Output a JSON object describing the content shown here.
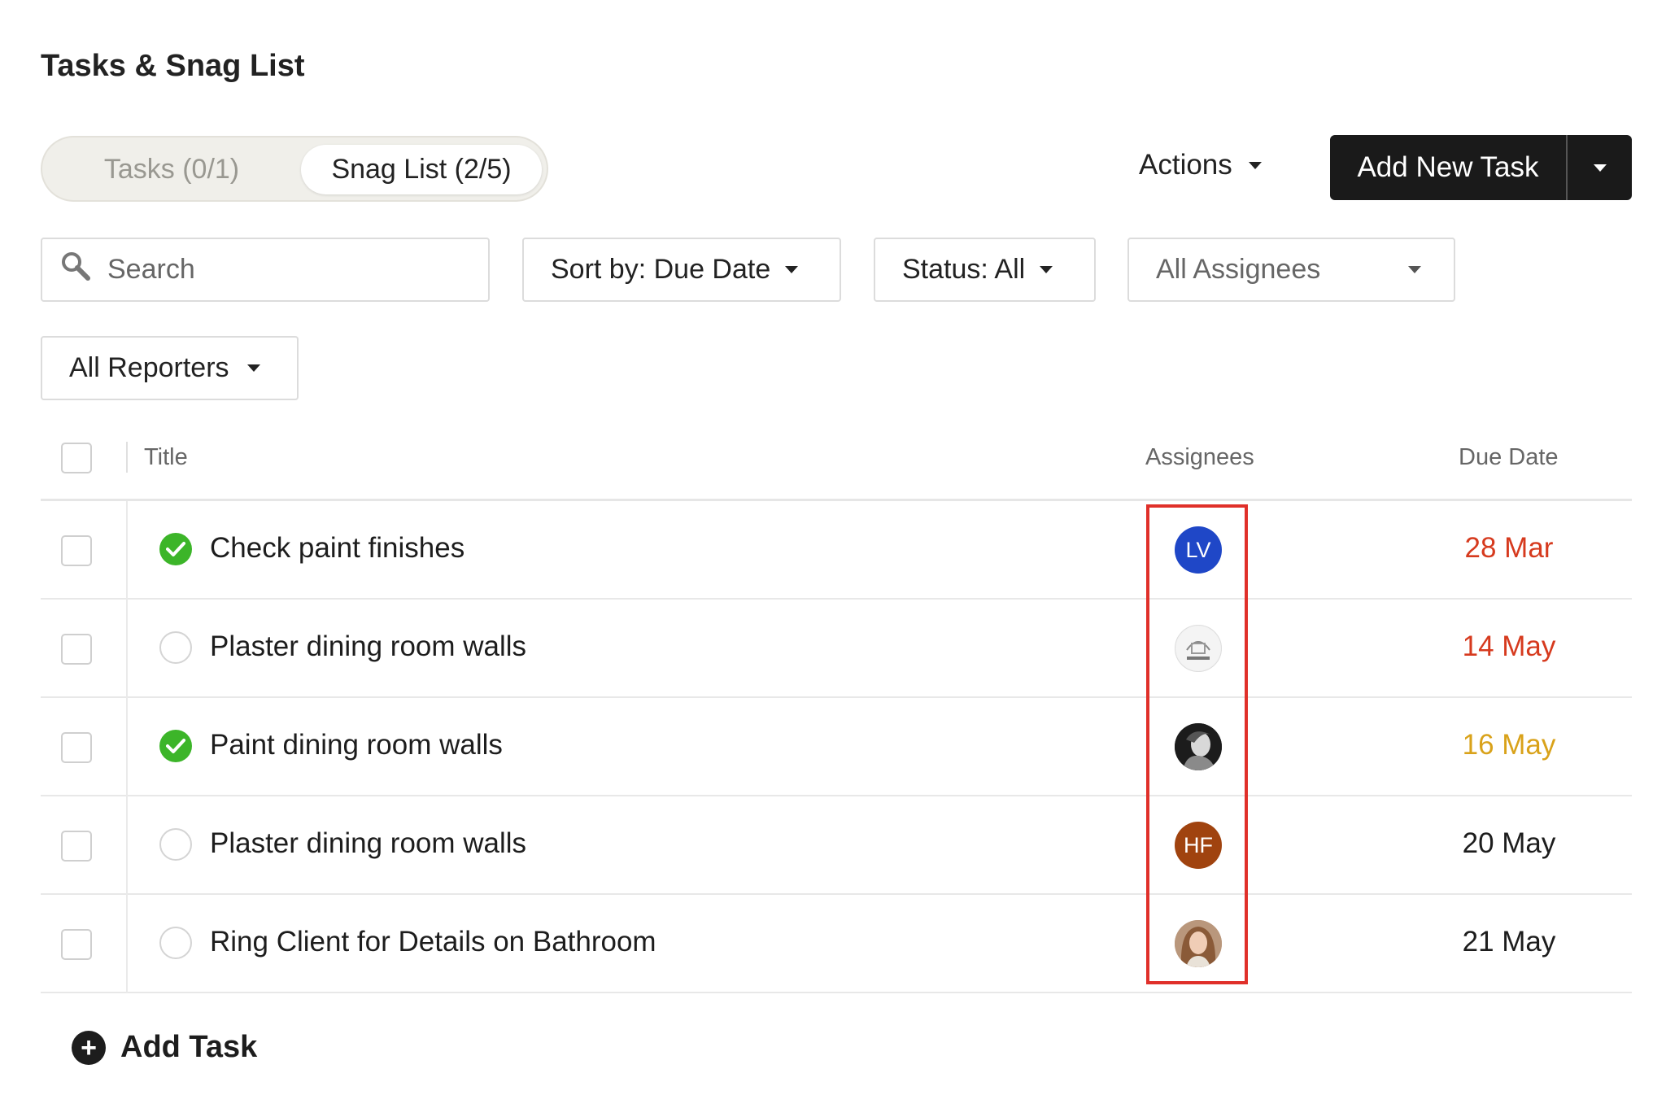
{
  "page": {
    "title": "Tasks & Snag List"
  },
  "segmented": {
    "tasks_label": "Tasks (0/1)",
    "snag_label": "Snag List (2/5)"
  },
  "toolbar": {
    "actions_label": "Actions",
    "add_new_label": "Add New Task"
  },
  "filters": {
    "search_placeholder": "Search",
    "sort_label": "Sort by: Due Date",
    "status_label": "Status: All",
    "assignees_label": "All Assignees",
    "reporters_label": "All Reporters"
  },
  "table": {
    "headers": {
      "title": "Title",
      "assignees": "Assignees",
      "due": "Due Date"
    },
    "rows": [
      {
        "title": "Check paint finishes",
        "done": true,
        "assignee": {
          "initials": "LV",
          "color": "#1f47c7",
          "kind": "initials"
        },
        "due": "28 Mar",
        "due_color": "#d63a1e"
      },
      {
        "title": "Plaster dining room walls",
        "done": false,
        "assignee": {
          "initials": "",
          "kind": "logo-design"
        },
        "due": "14 May",
        "due_color": "#d63a1e"
      },
      {
        "title": "Paint dining room walls",
        "done": true,
        "assignee": {
          "initials": "",
          "kind": "photo-dark"
        },
        "due": "16 May",
        "due_color": "#d9a21a"
      },
      {
        "title": "Plaster dining room walls",
        "done": false,
        "assignee": {
          "initials": "HF",
          "color": "#a0430f",
          "kind": "initials"
        },
        "due": "20 May",
        "due_color": "#1d1d1d"
      },
      {
        "title": "Ring Client for Details on Bathroom",
        "done": false,
        "assignee": {
          "initials": "",
          "kind": "photo-light"
        },
        "due": "21 May",
        "due_color": "#1d1d1d"
      }
    ]
  },
  "footer": {
    "add_task_label": "Add Task"
  },
  "colors": {
    "done_green": "#3cb529",
    "highlight_red": "#e0302a",
    "primary_dark": "#1a1a1a"
  }
}
